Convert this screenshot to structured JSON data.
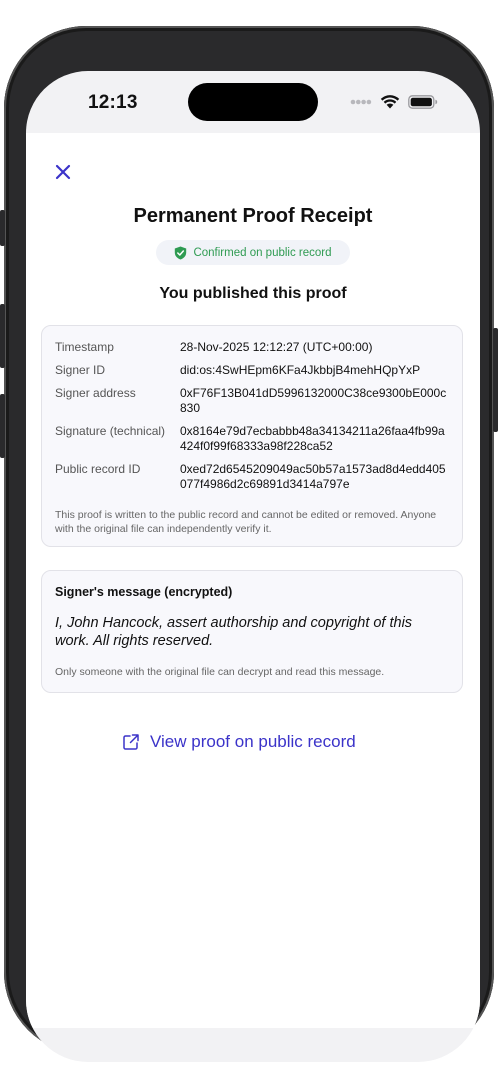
{
  "status_bar": {
    "time": "12:13"
  },
  "receipt": {
    "title": "Permanent Proof Receipt",
    "badge": "Confirmed on public record",
    "subtitle": "You published this proof"
  },
  "details": {
    "rows": [
      {
        "label": "Timestamp",
        "value": "28-Nov-2025 12:12:27 (UTC+00:00)"
      },
      {
        "label": "Signer ID",
        "value": "did:os:4SwHEpm6KFa4JkbbjB4mehHQpYxP"
      },
      {
        "label": "Signer address",
        "value": "0xF76F13B041dD5996132000C38ce9300bE000c830"
      },
      {
        "label": "Signature (technical)",
        "value": "0x8164e79d7ecbabbb48a34134211a26faa4fb99a424f0f99f68333a98f228ca52"
      },
      {
        "label": "Public record ID",
        "value": "0xed72d6545209049ac50b57a1573ad8d4edd405077f4986d2c69891d3414a797e"
      }
    ],
    "note": "This proof is written to the public record and cannot be edited or removed. Anyone with the original file can independently verify it."
  },
  "message": {
    "title": "Signer's message (encrypted)",
    "body": "I, John Hancock, assert authorship and copyright of this work. All rights reserved.",
    "note": "Only someone with the original file can decrypt and read this message."
  },
  "actions": {
    "view_link": "View proof on public record"
  },
  "colors": {
    "accent": "#3b33c9",
    "success": "#2f9b52",
    "card_bg": "#f8f8fc"
  },
  "icons": {
    "close": "close-icon",
    "badge": "shield-check-icon",
    "link": "external-link-icon"
  }
}
